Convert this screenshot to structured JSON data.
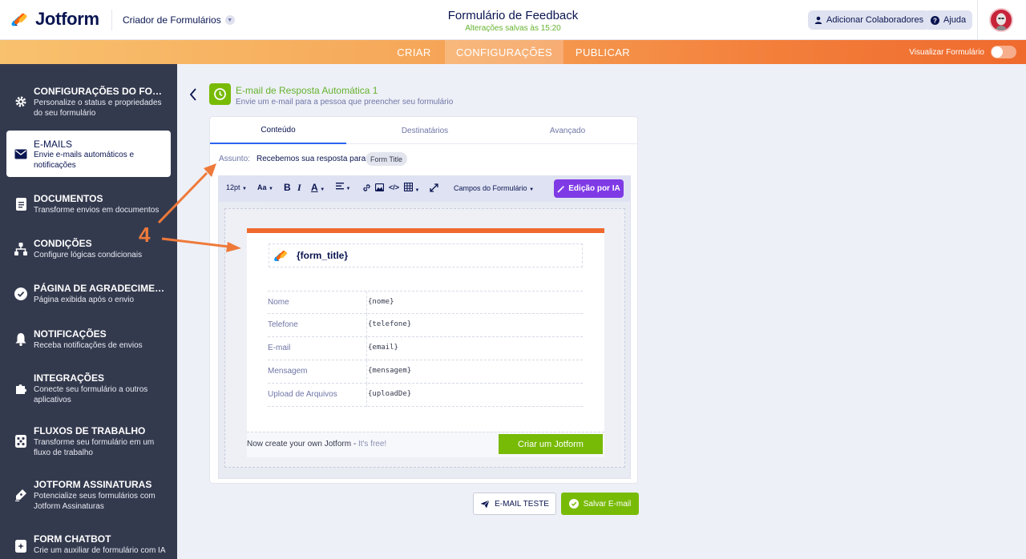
{
  "header": {
    "logo_text": "Jotform",
    "builder_label": "Criador de Formulários",
    "form_title": "Formulário de Feedback",
    "saved_status": "Alterações salvas às 15:20",
    "collaborators_label": "Adicionar Colaboradores",
    "help_label": "Ajuda"
  },
  "nav": {
    "tabs": [
      "CRIAR",
      "CONFIGURAÇÕES",
      "PUBLICAR"
    ],
    "active_tab": "CONFIGURAÇÕES",
    "preview_label": "Visualizar Formulário",
    "preview_on": false
  },
  "sidebar": {
    "items": [
      {
        "icon": "gear-icon",
        "title": "CONFIGURAÇÕES DO FORMULÁRIO",
        "desc": "Personalize o status e propriedades do seu formulário"
      },
      {
        "icon": "envelope-icon",
        "title": "E-MAILS",
        "desc": "Envie e-mails automáticos e notificações",
        "active": true
      },
      {
        "icon": "document-icon",
        "title": "DOCUMENTOS",
        "desc": "Transforme envios em documentos"
      },
      {
        "icon": "conditions-icon",
        "title": "CONDIÇÕES",
        "desc": "Configure lógicas condicionais"
      },
      {
        "icon": "check-circle-icon",
        "title": "PÁGINA DE AGRADECIMENTO",
        "desc": "Página exibida após o envio"
      },
      {
        "icon": "bell-icon",
        "title": "NOTIFICAÇÕES",
        "desc": "Receba notificações de envios"
      },
      {
        "icon": "puzzle-icon",
        "title": "INTEGRAÇÕES",
        "desc": "Conecte seu formulário a outros aplicativos"
      },
      {
        "icon": "workflow-icon",
        "title": "FLUXOS DE TRABALHO",
        "desc": "Transforme seu formulário em um fluxo de trabalho"
      },
      {
        "icon": "signature-icon",
        "title": "JOTFORM ASSINATURAS",
        "desc": "Potencialize seus formulários com Jotform Assinaturas"
      },
      {
        "icon": "chatbot-icon",
        "title": "FORM CHATBOT",
        "desc": "Crie um auxiliar de formulário com IA"
      }
    ]
  },
  "email": {
    "title": "E-mail de Resposta Automática 1",
    "subtitle": "Envie um e-mail para a pessoa que preencher seu formulário",
    "tabs": [
      "Conteúdo",
      "Destinatários",
      "Avançado"
    ],
    "active_tab": "Conteúdo",
    "subject_label": "Assunto:",
    "subject_text": "Recebemos sua resposta para",
    "subject_tag": "Form Title"
  },
  "toolbar": {
    "font_size": "12pt",
    "text_style": "Aa",
    "bold": "B",
    "italic": "I",
    "color": "A",
    "fields_dropdown": "Campos do Formulário",
    "ai_button": "Edição por IA"
  },
  "mail": {
    "form_title_var": "{form_title}",
    "rows": [
      {
        "label": "Nome",
        "value": "{nome}"
      },
      {
        "label": "Telefone",
        "value": "{telefone}"
      },
      {
        "label": "E-mail",
        "value": "{email}"
      },
      {
        "label": "Mensagem",
        "value": "{mensagem}"
      },
      {
        "label": "Upload de Arquivos",
        "value": "{uploadDe}"
      }
    ],
    "footer_text": "Now create your own Jotform - ",
    "footer_free": "It's free!",
    "cta_button": "Criar um Jotform"
  },
  "actions": {
    "test_label": "E-MAIL TESTE",
    "save_label": "Salvar E-mail"
  },
  "annotation": {
    "number": "4",
    "color": "#ee7a3a"
  }
}
